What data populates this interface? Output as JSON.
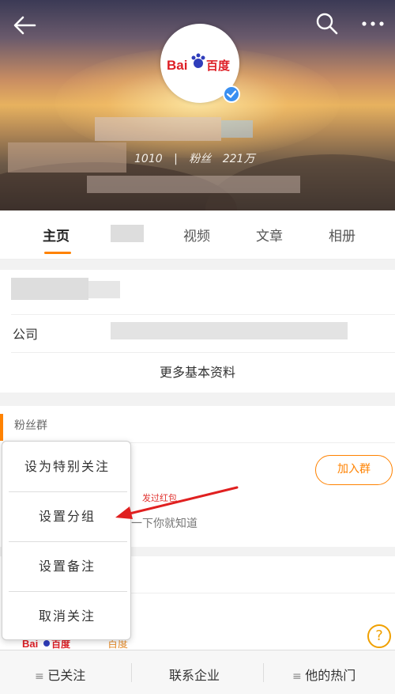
{
  "header": {
    "back_icon": "back-arrow-icon",
    "search_icon": "search-icon",
    "more_icon": "more-dots-icon",
    "avatar_logo": "Bai百度",
    "stats_following": "1010",
    "stats_separator": "|",
    "stats_fans_label": "粉丝",
    "stats_fans_value": "221万"
  },
  "tabs": [
    {
      "label": "主页"
    },
    {
      "label": "视频"
    },
    {
      "label": "文章"
    },
    {
      "label": "相册"
    }
  ],
  "info": {
    "more_info": "更多基本资料",
    "row_label": "公司"
  },
  "fan_group": {
    "title": "粉丝群",
    "join_button": "加入群",
    "red_badge": "发过红包",
    "desc": "一下你就知道"
  },
  "menu": {
    "items": [
      {
        "label": "设为特别关注"
      },
      {
        "label": "设置分组"
      },
      {
        "label": "设置备注"
      },
      {
        "label": "取消关注"
      }
    ]
  },
  "lower": {
    "logo": "Bai百度",
    "text": "百度"
  },
  "bottom_bar": {
    "followed": "已关注",
    "contact": "联系企业",
    "hot": "他的热门",
    "help": "?"
  },
  "colors": {
    "accent": "#ff8200",
    "arrow": "#e02020",
    "verified": "#3a8ff0"
  }
}
